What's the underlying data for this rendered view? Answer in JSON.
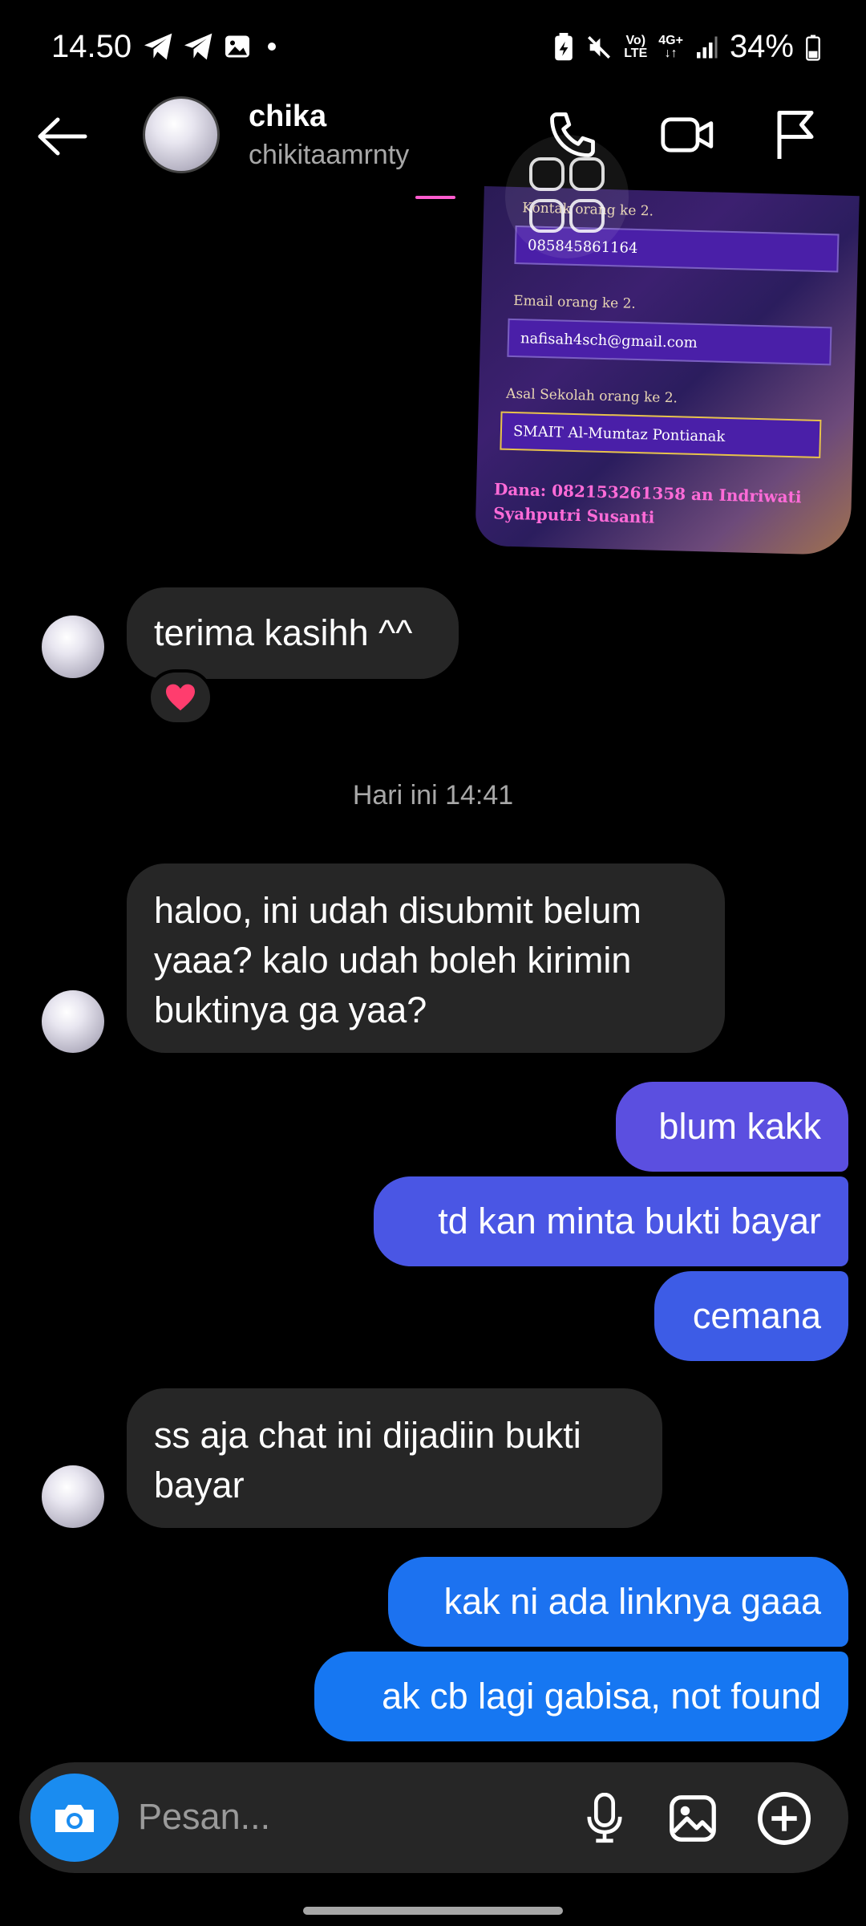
{
  "status_bar": {
    "time": "14.50",
    "network_top": "Vo)",
    "network_bottom": "LTE",
    "network_gen": "4G+",
    "battery": "34%"
  },
  "header": {
    "name": "chika",
    "username": "chikitaamrnty"
  },
  "shared_image": {
    "field1_label": "Kontak orang ke 2.",
    "field1_value": "085845861164",
    "field2_label": "Email orang ke 2.",
    "field2_value": "nafisah4sch@gmail.com",
    "field3_label": "Asal Sekolah orang ke 2.",
    "field3_value": "SMAIT Al-Mumtaz Pontianak",
    "footer_line1": "Dana: 082153261358 an Indriwati",
    "footer_line2": "Syahputri Susanti"
  },
  "messages": {
    "m1": "terima kasihh ^^",
    "m1_reaction": "❤️",
    "timestamp": "Hari ini 14:41",
    "m2_l1": "haloo, ini udah disubmit belum",
    "m2_l2": "yaaa? kalo udah boleh kirimin",
    "m2_l3": "buktinya ga yaa?",
    "m3": "blum kakk",
    "m4": "td kan minta bukti bayar",
    "m5": "cemana",
    "m6_l1": "ss aja chat ini dijadiin bukti",
    "m6_l2": "bayar",
    "m7": "kak ni ada linknya gaaa",
    "m8": "ak cb lagi gabisa, not found"
  },
  "composer": {
    "placeholder": "Pesan..."
  },
  "colors": {
    "incoming_bubble": "#262626",
    "outgoing_purple": "#5b4fe0",
    "outgoing_indigo": "#3d5ce6",
    "outgoing_blue": "#1677f2",
    "camera_button": "#1a8cf0"
  },
  "icons": {
    "back": "arrow-left-icon",
    "call": "phone-icon",
    "video": "video-camera-icon",
    "report": "flag-icon",
    "camera": "camera-icon",
    "mic": "microphone-icon",
    "gallery": "image-icon",
    "add": "plus-circle-icon"
  }
}
